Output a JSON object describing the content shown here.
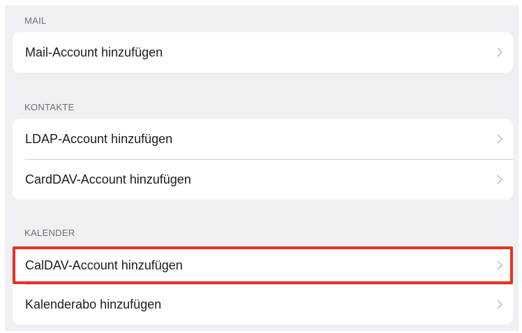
{
  "mail": {
    "header": "MAIL",
    "items": [
      {
        "label": "Mail-Account hinzufügen"
      }
    ]
  },
  "contacts": {
    "header": "KONTAKTE",
    "items": [
      {
        "label": "LDAP-Account hinzufügen"
      },
      {
        "label": "CardDAV-Account hinzufügen"
      }
    ]
  },
  "calendar": {
    "header": "KALENDER",
    "items": [
      {
        "label": "CalDAV-Account hinzufügen"
      },
      {
        "label": "Kalenderabo hinzufügen"
      }
    ]
  },
  "colors": {
    "background": "#efeff4",
    "card": "#ffffff",
    "highlight": "#e8321f",
    "chevron": "#c4c4c7"
  },
  "icons": {
    "disclosure": "chevron-right-icon"
  }
}
